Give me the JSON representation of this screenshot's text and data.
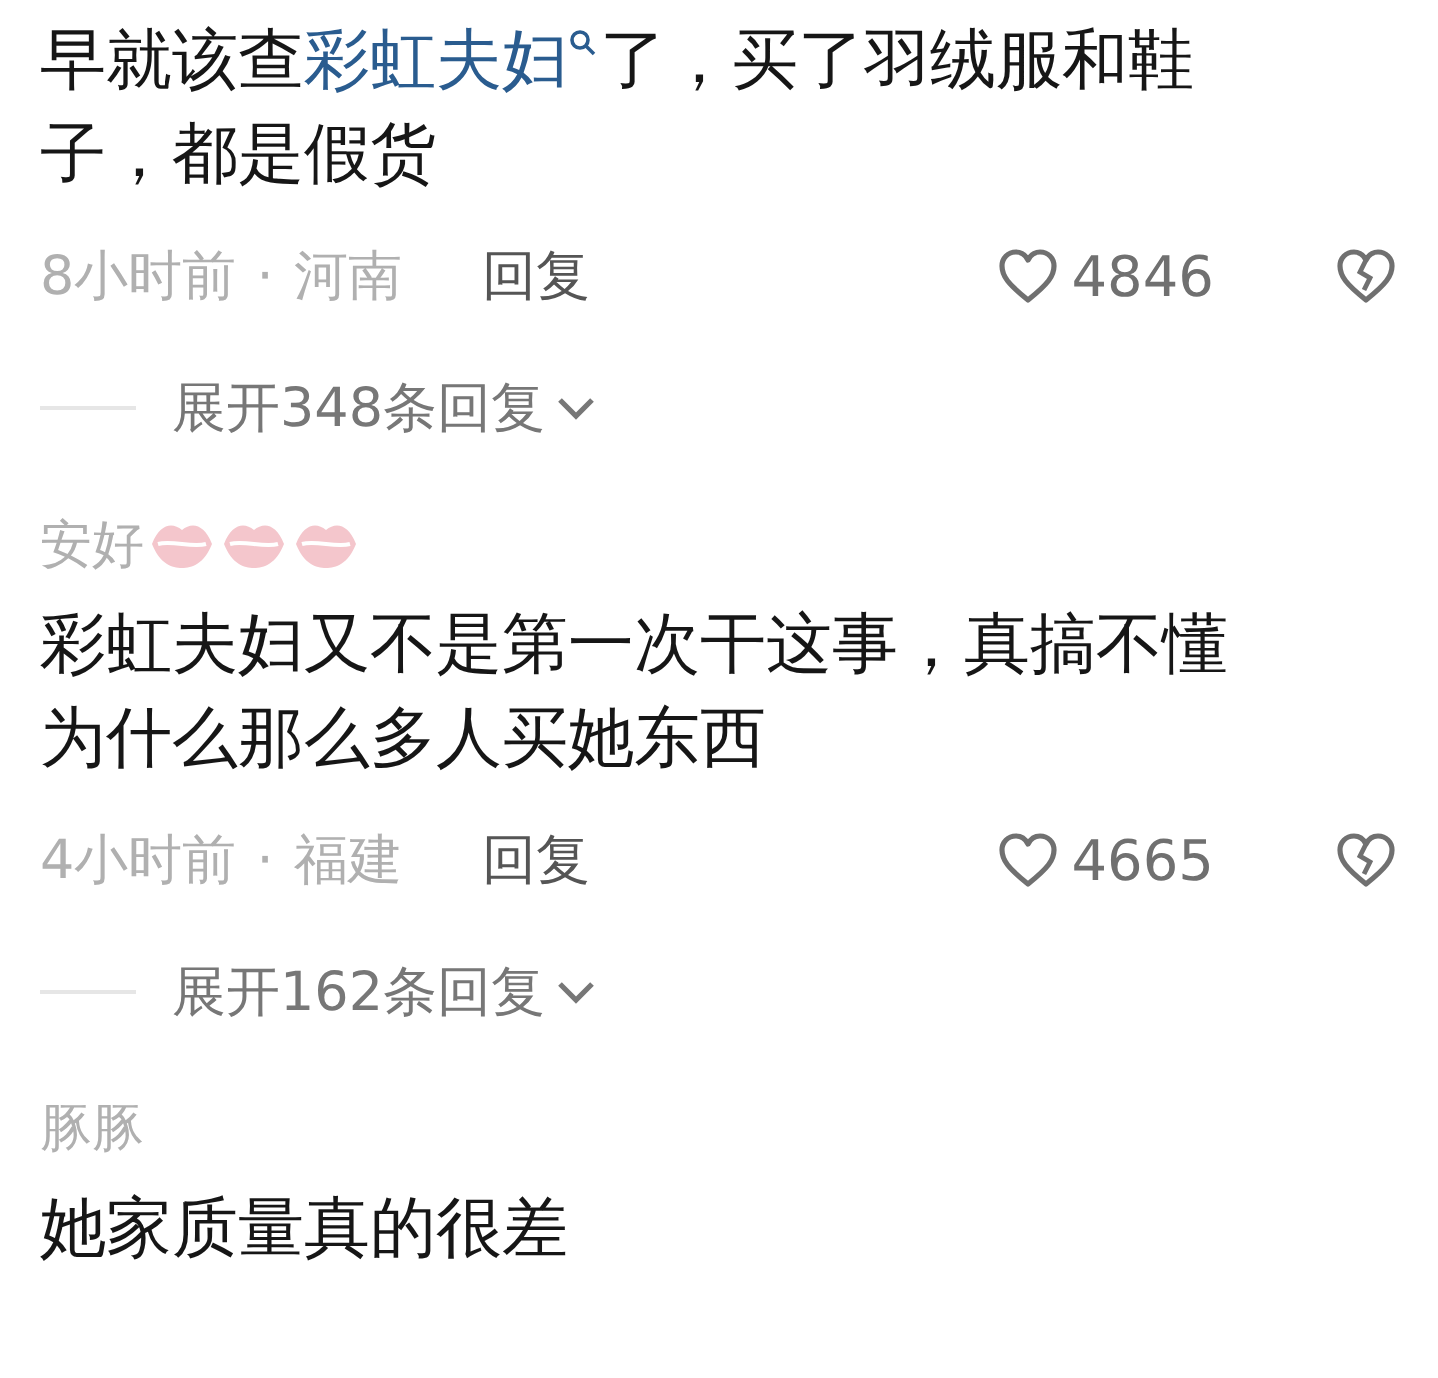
{
  "comments": [
    {
      "lines": [
        [
          {
            "kind": "text",
            "text": "早就该查"
          },
          {
            "kind": "link",
            "text": "彩虹夫妇"
          },
          {
            "kind": "text",
            "text": "了，买了羽绒服和鞋"
          }
        ],
        [
          {
            "kind": "text",
            "text": "子，都是假货"
          }
        ]
      ],
      "time": "8小时前",
      "separator": "·",
      "location": "河南",
      "reply": "回复",
      "likes": "4846",
      "expand": "展开348条回复"
    },
    {
      "user": "安好",
      "badges": [
        {
          "kind": "lips"
        },
        {
          "kind": "lips"
        },
        {
          "kind": "lips"
        }
      ],
      "lines": [
        [
          {
            "kind": "text",
            "text": "彩虹夫妇又不是第一次干这事，真搞不懂"
          }
        ],
        [
          {
            "kind": "text",
            "text": "为什么那么多人买她东西"
          }
        ]
      ],
      "time": "4小时前",
      "separator": "·",
      "location": "福建",
      "reply": "回复",
      "likes": "4665",
      "expand": "展开162条回复"
    },
    {
      "user": "豚豚",
      "lines": [
        [
          {
            "kind": "text",
            "text": "她家质量真的很差"
          }
        ]
      ]
    }
  ]
}
